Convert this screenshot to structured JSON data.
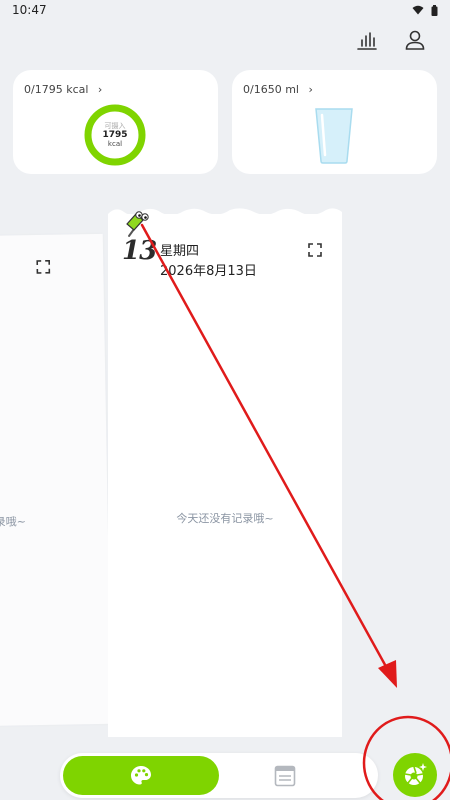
{
  "status_bar": {
    "time": "10:47",
    "icons": [
      "wifi-icon",
      "battery-icon"
    ]
  },
  "header": {
    "icons": [
      "bar-chart-icon",
      "user-icon"
    ]
  },
  "calorie_card": {
    "summary": "0/1795 kcal",
    "ring_label": "可摄入",
    "ring_value": "1795",
    "ring_unit": "kcal",
    "progress": 0,
    "ring_color": "#7fd400"
  },
  "water_card": {
    "summary": "0/1650 ml",
    "progress": 0,
    "glass_color": "#d6f0fa"
  },
  "diary": {
    "current_page": {
      "day": "13",
      "weekday": "星期四",
      "date": "2026年8月13日",
      "empty_message": "今天还没有记录哦~"
    },
    "previous_page": {
      "empty_message": "录哦~"
    }
  },
  "bottom_nav": {
    "tabs": [
      {
        "name": "palette-icon",
        "active": true
      },
      {
        "name": "diary-icon",
        "active": false
      }
    ],
    "fab_icon": "camera-sparkle-icon",
    "accent": "#7fd400"
  },
  "annotation": {
    "color": "#e01b1b"
  }
}
